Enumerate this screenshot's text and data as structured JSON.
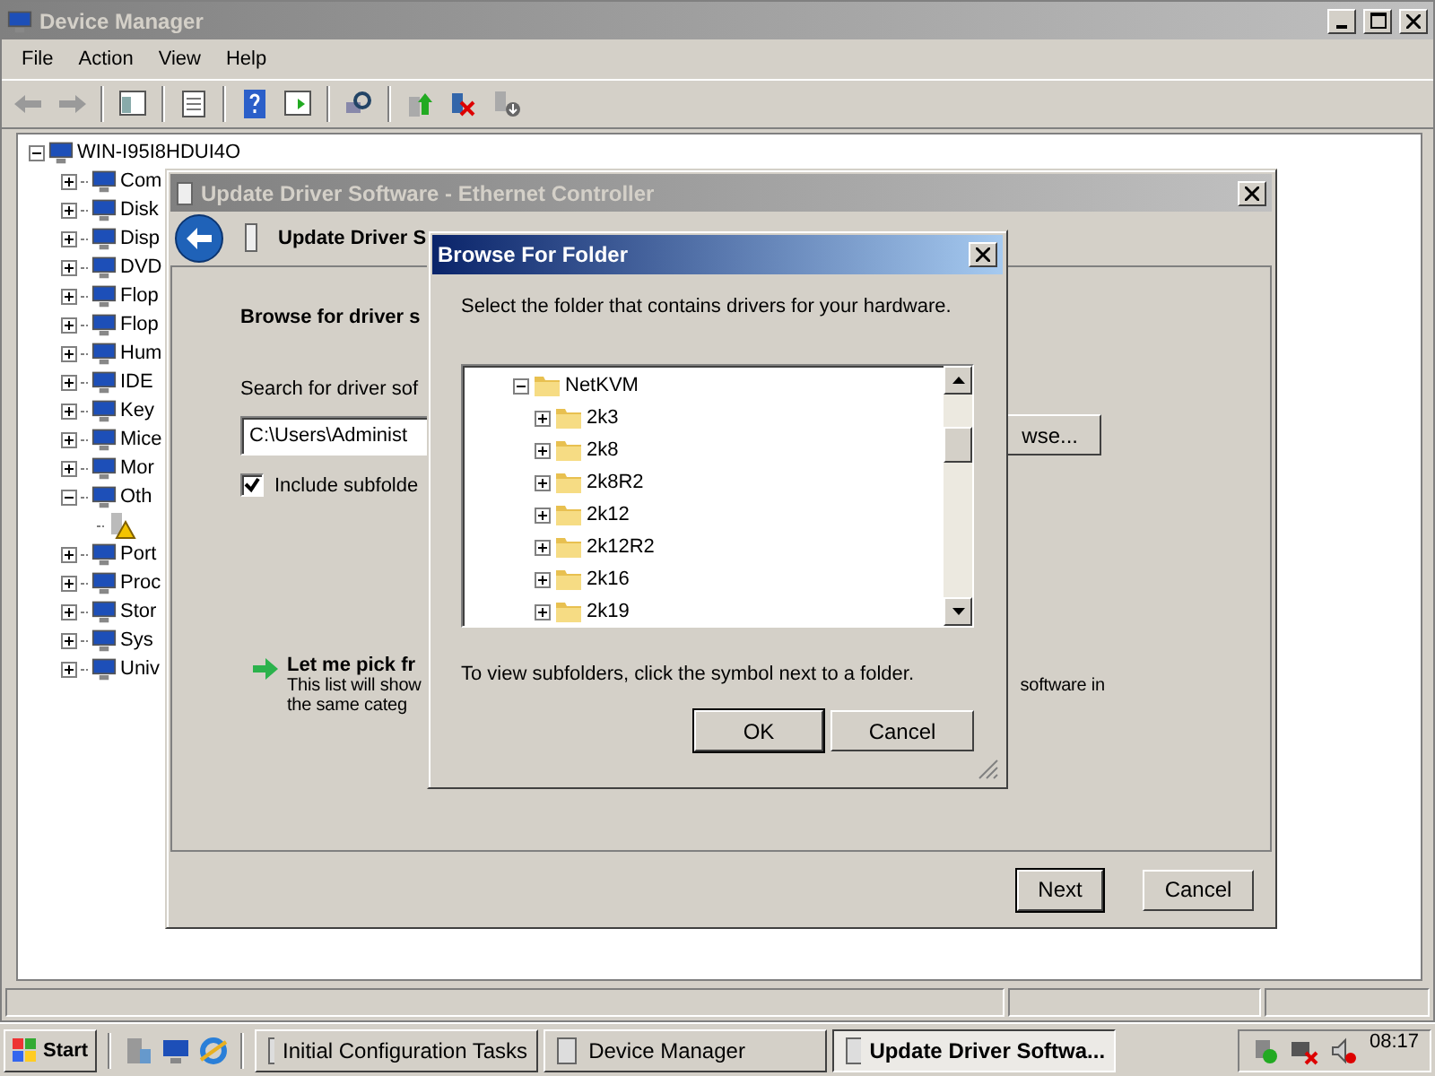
{
  "device_manager": {
    "title": "Device Manager",
    "menu": [
      "File",
      "Action",
      "View",
      "Help"
    ],
    "tree": {
      "root": "WIN-I95I8HDUI4O",
      "items": [
        {
          "label": "Com",
          "expanded": false
        },
        {
          "label": "Disk",
          "expanded": false
        },
        {
          "label": "Disp",
          "expanded": false
        },
        {
          "label": "DVD",
          "expanded": false
        },
        {
          "label": "Flop",
          "expanded": false
        },
        {
          "label": "Flop",
          "expanded": false
        },
        {
          "label": "Hum",
          "expanded": false
        },
        {
          "label": "IDE",
          "expanded": false
        },
        {
          "label": "Key",
          "expanded": false
        },
        {
          "label": "Mice",
          "expanded": false
        },
        {
          "label": "Mor",
          "expanded": false
        },
        {
          "label": "Oth",
          "expanded": true,
          "children": [
            {
              "kind": "warning"
            }
          ]
        },
        {
          "label": "Port",
          "expanded": false
        },
        {
          "label": "Proc",
          "expanded": false
        },
        {
          "label": "Stor",
          "expanded": false
        },
        {
          "label": "Sys",
          "expanded": false
        },
        {
          "label": "Univ",
          "expanded": false
        }
      ]
    }
  },
  "update_driver": {
    "title": "Update Driver Software - Ethernet Controller",
    "header": "Update Driver S",
    "heading": "Browse for driver s",
    "search_label": "Search for driver sof",
    "path_value": "C:\\Users\\Administ",
    "browse_button": "wse...",
    "include_subfolders": {
      "label": "Include subfolde",
      "checked": true
    },
    "pick": {
      "title": "Let me pick fr",
      "line_1": "This list will show",
      "line_1_end": "software in",
      "line_2": "the same categ"
    },
    "buttons": [
      "Next",
      "Cancel"
    ]
  },
  "browse_dialog": {
    "title": "Browse For Folder",
    "prompt": "Select the folder that contains drivers for your hardware.",
    "tree": {
      "label": "NetKVM",
      "expanded": true,
      "children": [
        {
          "label": "2k3",
          "expanded": false
        },
        {
          "label": "2k8",
          "expanded": false
        },
        {
          "label": "2k8R2",
          "expanded": false
        },
        {
          "label": "2k12",
          "expanded": false
        },
        {
          "label": "2k12R2",
          "expanded": false
        },
        {
          "label": "2k16",
          "expanded": false
        },
        {
          "label": "2k19",
          "expanded": false
        }
      ]
    },
    "hint": "To view subfolders, click the symbol next to a folder.",
    "buttons": [
      "OK",
      "Cancel"
    ]
  },
  "taskbar": {
    "start": "Start",
    "tasks": [
      {
        "label": "Initial Configuration Tasks",
        "selected": false
      },
      {
        "label": "Device Manager",
        "selected": false
      },
      {
        "label": "Update Driver Softwa...",
        "selected": true
      }
    ],
    "clock": "08:17"
  }
}
